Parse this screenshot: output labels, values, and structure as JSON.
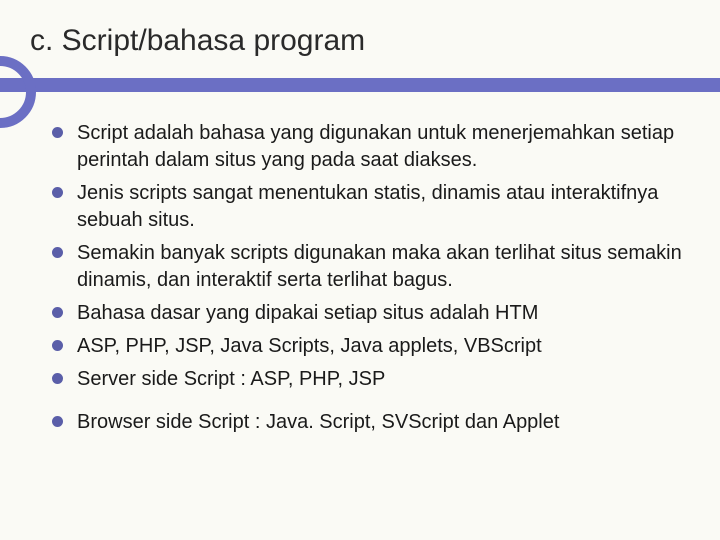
{
  "slide": {
    "title": "c. Script/bahasa program",
    "bullets": [
      {
        "text": "Script adalah bahasa yang digunakan untuk menerjemahkan setiap perintah dalam situs yang pada saat diakses."
      },
      {
        "text": "Jenis scripts sangat menentukan statis, dinamis atau interaktifnya sebuah situs."
      },
      {
        "text": " Semakin banyak scripts digunakan maka akan terlihat situs semakin dinamis, dan interaktif serta terlihat bagus."
      },
      {
        "text": "Bahasa dasar yang dipakai setiap situs adalah HTM"
      },
      {
        "text": "ASP, PHP, JSP, Java Scripts, Java applets, VBScript"
      },
      {
        "text": "Server side Script : ASP, PHP, JSP"
      },
      {
        "text": "Browser side Script : Java. Script, SVScript dan Applet"
      }
    ]
  }
}
